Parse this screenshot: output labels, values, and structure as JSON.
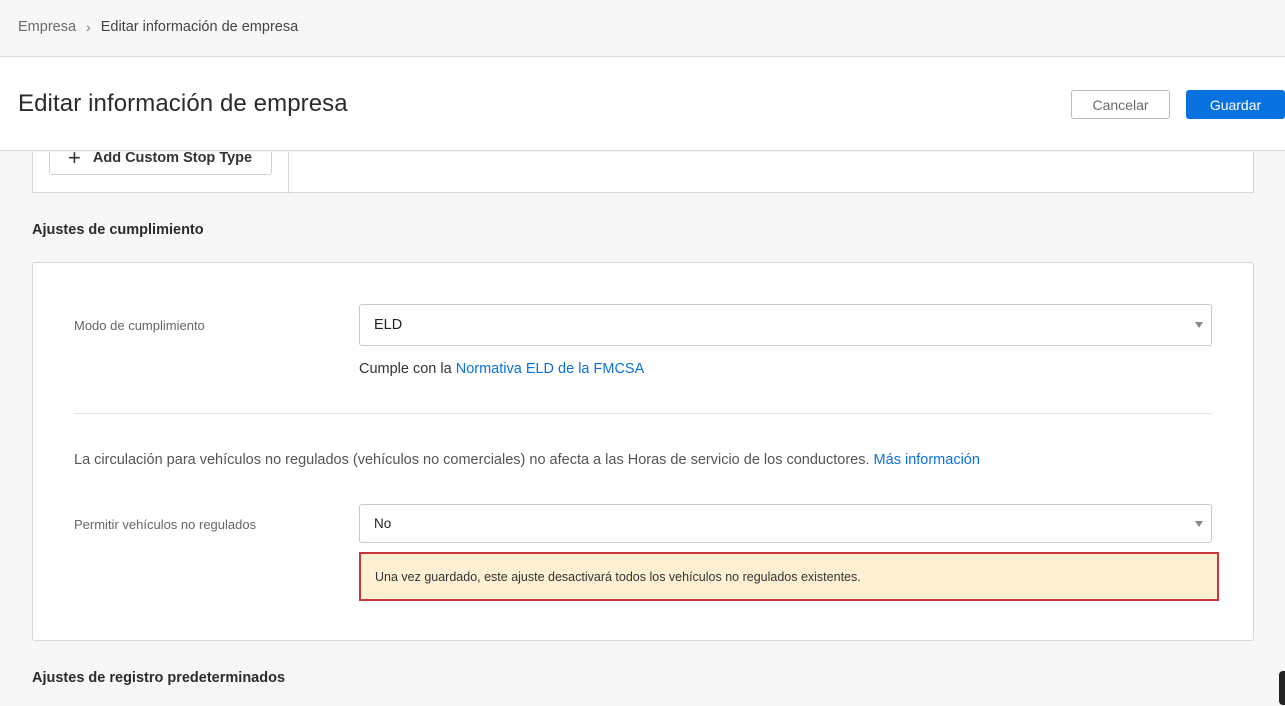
{
  "breadcrumb": {
    "parent": "Empresa",
    "separator": "›",
    "current": "Editar información de empresa"
  },
  "header": {
    "title": "Editar información de empresa",
    "cancel_label": "Cancelar",
    "save_label": "Guardar"
  },
  "stop_types": {
    "add_button_label": "Add Custom Stop Type",
    "add_icon": "plus-icon"
  },
  "compliance": {
    "heading": "Ajustes de cumplimiento",
    "mode_label": "Modo de cumplimiento",
    "mode_value": "ELD",
    "mode_help_prefix": "Cumple con la",
    "mode_help_link": "Normativa ELD de la FMCSA",
    "unregulated_info": "La circulación para vehículos no regulados (vehículos no comerciales) no afecta a las Horas de servicio de los conductores.",
    "unregulated_info_link": "Más información",
    "allow_unregulated_label": "Permitir vehículos no regulados",
    "allow_unregulated_value": "No",
    "warning": "Una vez guardado, este ajuste desactivará todos los vehículos no regulados existentes."
  },
  "log_settings": {
    "heading": "Ajustes de registro predeterminados"
  },
  "colors": {
    "primary": "#0a72e0",
    "warning_bg": "#fff0d3",
    "warning_border": "#c9363b"
  }
}
